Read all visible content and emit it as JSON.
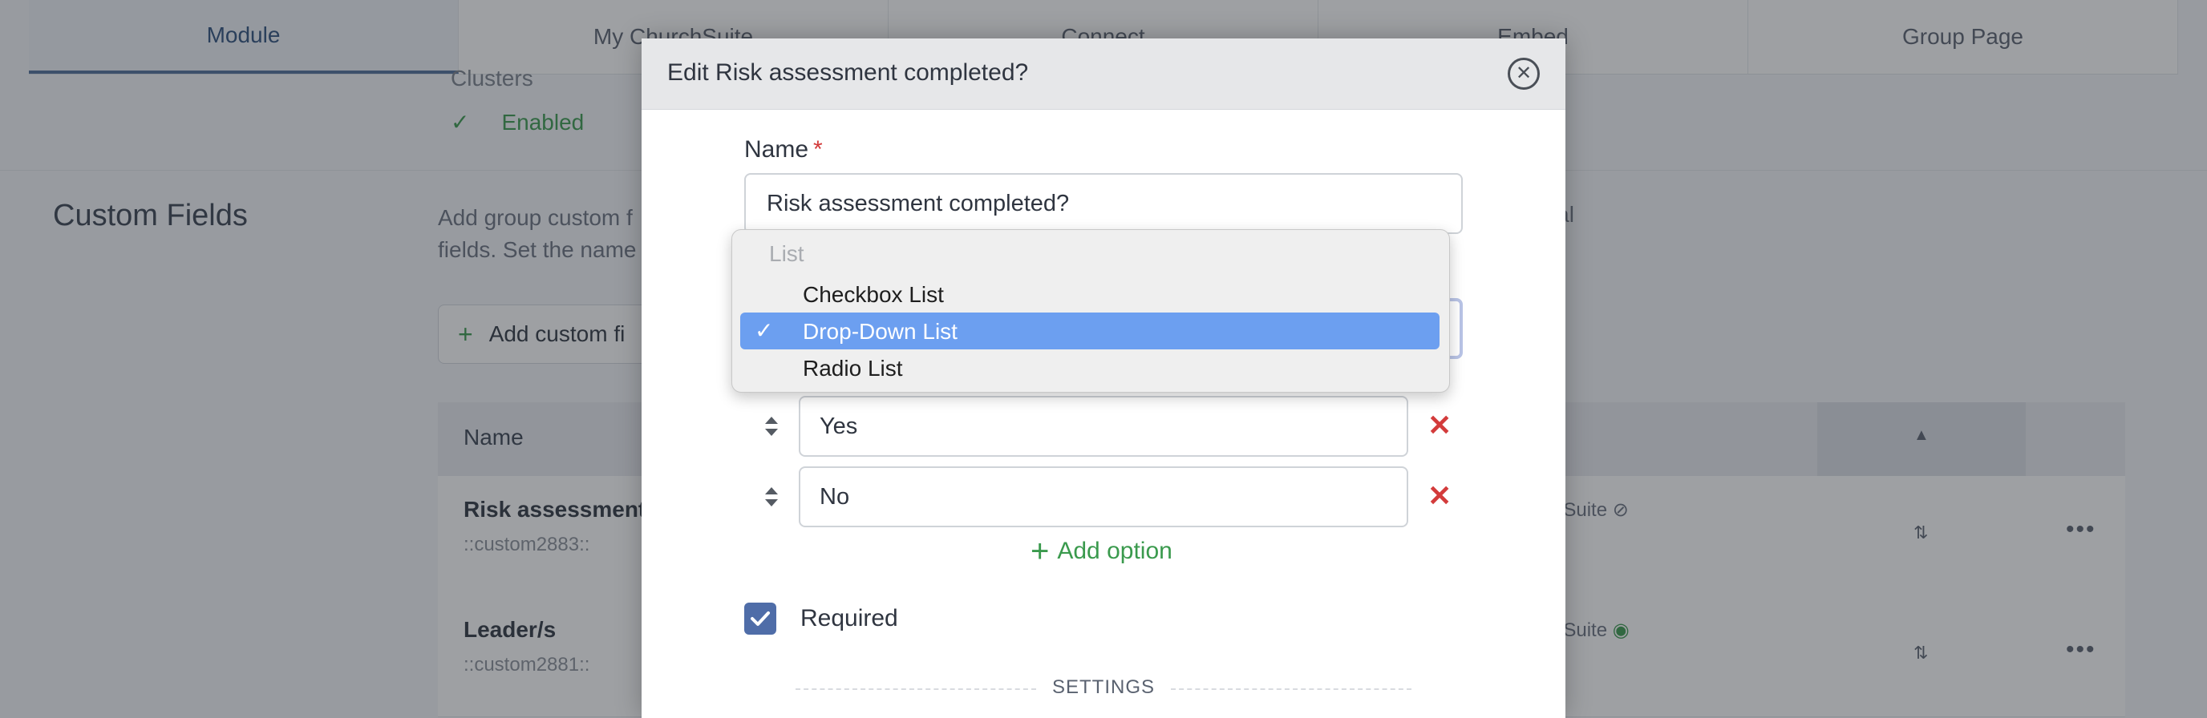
{
  "tabs": [
    "Module",
    "My ChurchSuite",
    "Connect",
    "Embed",
    "Group Page"
  ],
  "clusters": {
    "label": "Clusters",
    "status": "Enabled"
  },
  "custom_fields": {
    "title": "Custom Fields",
    "description": "Add group custom f fields. Set the name",
    "description_tail": "onal",
    "add_button": "Add custom fi",
    "table": {
      "column_name": "Name",
      "rows": [
        {
          "name": "Risk assessment c",
          "code": "::custom2883::",
          "visibility": "hSuite"
        },
        {
          "name": "Leader/s",
          "code": "::custom2881::",
          "visibility": "hSuite"
        }
      ]
    }
  },
  "modal": {
    "title": "Edit Risk assessment completed?",
    "name_label": "Name",
    "required_mark": "*",
    "name_value": "Risk assessment completed?",
    "options": [
      "Yes",
      "No"
    ],
    "add_option": "Add option",
    "required_label": "Required",
    "required_checked": true,
    "settings_label": "SETTINGS"
  },
  "dropdown": {
    "group_label": "List",
    "items": [
      "Checkbox List",
      "Drop-Down List",
      "Radio List"
    ],
    "selected": "Drop-Down List",
    "selected_color": "#6c9ff0"
  },
  "colors": {
    "accent": "#4f6da8",
    "success": "#3a9a4d",
    "danger": "#d33b3b"
  }
}
